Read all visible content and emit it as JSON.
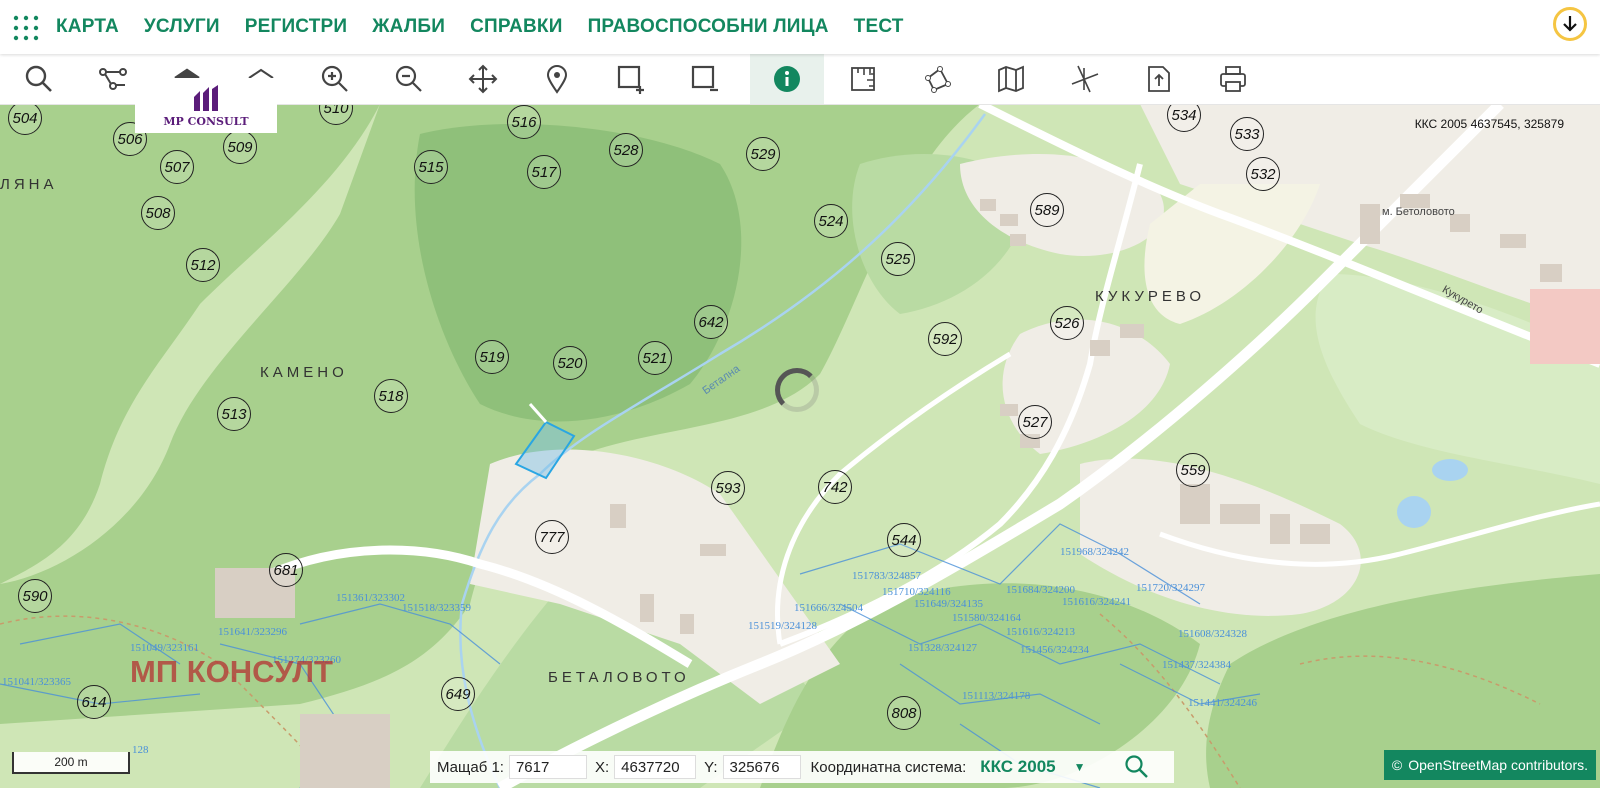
{
  "nav": {
    "menu": [
      "КАРТА",
      "УСЛУГИ",
      "РЕГИСТРИ",
      "ЖАЛБИ",
      "СПРАВКИ",
      "ПРАВОСПОСОБНИ ЛИЦА",
      "ТЕСТ"
    ]
  },
  "toolbar": {
    "tools": [
      "search-icon",
      "route-icon",
      "layers-up-icon",
      "layers-down-icon",
      "zoom-in-icon",
      "zoom-out-icon",
      "pan-icon",
      "location-pin-icon",
      "add-rect-icon",
      "remove-rect-icon",
      "info-icon",
      "measure-icon",
      "polygon-icon",
      "map-icon",
      "intersect-icon",
      "export-icon",
      "print-icon"
    ],
    "active": "info-icon"
  },
  "logo": {
    "text": "MP CONSULT"
  },
  "map": {
    "coord_readout": "ККС 2005 4637545, 325879",
    "watermark": "МП КОНСУЛТ",
    "places": {
      "kameno": "КАМЕНО",
      "kukurevo": "КУКУРЕВО",
      "betalovoto": "БЕТАЛОВОТО",
      "polyana": "ЛЯНА",
      "m_betalovoto": "м. Бетоловото",
      "kukurevo_street": "Кукурето",
      "river": "Бетална"
    },
    "parcels": [
      "504",
      "506",
      "507",
      "508",
      "509",
      "510",
      "512",
      "513",
      "515",
      "516",
      "517",
      "518",
      "519",
      "520",
      "521",
      "524",
      "525",
      "526",
      "527",
      "528",
      "529",
      "532",
      "533",
      "534",
      "544",
      "559",
      "589",
      "590",
      "592",
      "593",
      "614",
      "642",
      "649",
      "681",
      "742",
      "777",
      "808"
    ],
    "plots": [
      "151361/323302",
      "151518/323359",
      "151641/323296",
      "151049/323161",
      "151274/323260",
      "151041/323365",
      "151783/324857",
      "151710/324116",
      "151649/324135",
      "151684/324200",
      "151616/324241",
      "151720/324297",
      "151666/324504",
      "151580/324164",
      "151519/324128",
      "151616/324213",
      "151328/324127",
      "151456/324234",
      "151608/324328",
      "151437/324384",
      "151113/324178",
      "151441/324246",
      "151968/324242",
      "128"
    ],
    "colors": {
      "forest": "#a8d08d",
      "forest_dark": "#8fc07a",
      "meadow": "#cfe6b6",
      "urban": "#f0ede6",
      "road": "#ffffff",
      "water": "#a9d3f0",
      "parcel_line": "#4a90d9",
      "accent": "#13875f"
    }
  },
  "scale": {
    "label": "200 m"
  },
  "status": {
    "scale_label": "Мащаб 1:",
    "scale_value": "7617",
    "x_label": "X:",
    "x_value": "4637720",
    "y_label": "Y:",
    "y_value": "325676",
    "crs_label": "Координатна система:",
    "crs_value": "ККС 2005"
  },
  "attribution": {
    "symbol": "©",
    "text": "OpenStreetMap contributors."
  }
}
